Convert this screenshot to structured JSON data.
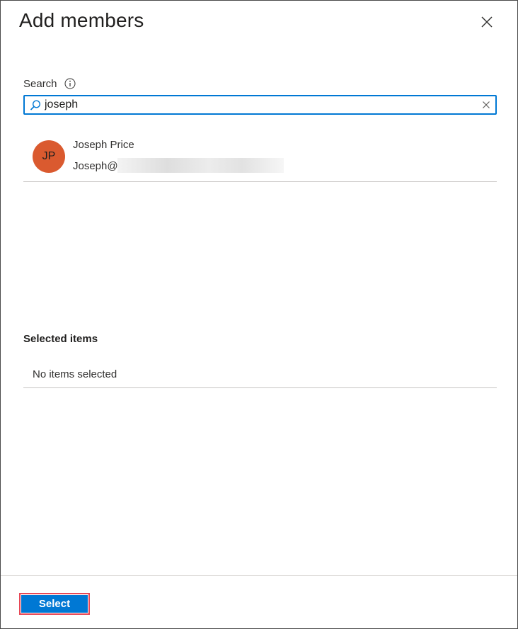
{
  "panel": {
    "title": "Add members",
    "close_icon": "close-icon"
  },
  "search": {
    "label": "Search",
    "info_icon": "info-icon",
    "value": "joseph",
    "search_icon": "search-icon",
    "clear_icon": "clear-icon"
  },
  "results": [
    {
      "initials": "JP",
      "name": "Joseph Price",
      "email_visible": "Joseph@",
      "avatar_color": "#da5a2f"
    }
  ],
  "selected_items": {
    "header": "Selected items",
    "empty_text": "No items selected"
  },
  "footer": {
    "select_label": "Select"
  },
  "colors": {
    "accent": "#0078d4",
    "highlight_outline": "#e74856",
    "avatar": "#da5a2f"
  }
}
